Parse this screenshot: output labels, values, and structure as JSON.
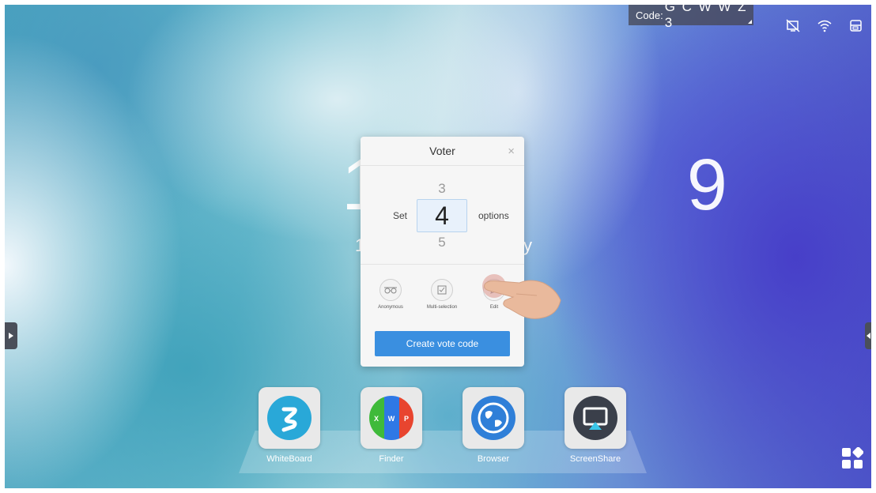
{
  "topbar": {
    "code_label": "Code:",
    "code_value": "G C W W Z 3"
  },
  "status_icons": [
    "no-signal-icon",
    "wifi-icon",
    "screen-cast-icon"
  ],
  "clock": {
    "big_text": "1 9",
    "small_left": "1",
    "small_right": "y"
  },
  "dialog": {
    "title": "Voter",
    "close": "×",
    "picker": {
      "set_label": "Set",
      "options_label": "options",
      "above_faint": "",
      "above": "3",
      "selected": "4",
      "below": "5",
      "below_faint": ""
    },
    "options": [
      {
        "label": "Anonymous",
        "icon": "anonymous-glasses-icon"
      },
      {
        "label": "Multi-selection",
        "icon": "checkbox-icon"
      },
      {
        "label": "Edit",
        "icon": "edit-icon"
      }
    ],
    "create_button": "Create vote code"
  },
  "dock": {
    "apps": [
      {
        "label": "WhiteBoard",
        "icon": "whiteboard-icon"
      },
      {
        "label": "Finder",
        "icon": "finder-icon"
      },
      {
        "label": "Browser",
        "icon": "browser-globe-icon"
      },
      {
        "label": "ScreenShare",
        "icon": "screenshare-icon"
      }
    ]
  },
  "colors": {
    "accent": "#3a8fe0",
    "dialog_bg": "#f6f6f6"
  }
}
